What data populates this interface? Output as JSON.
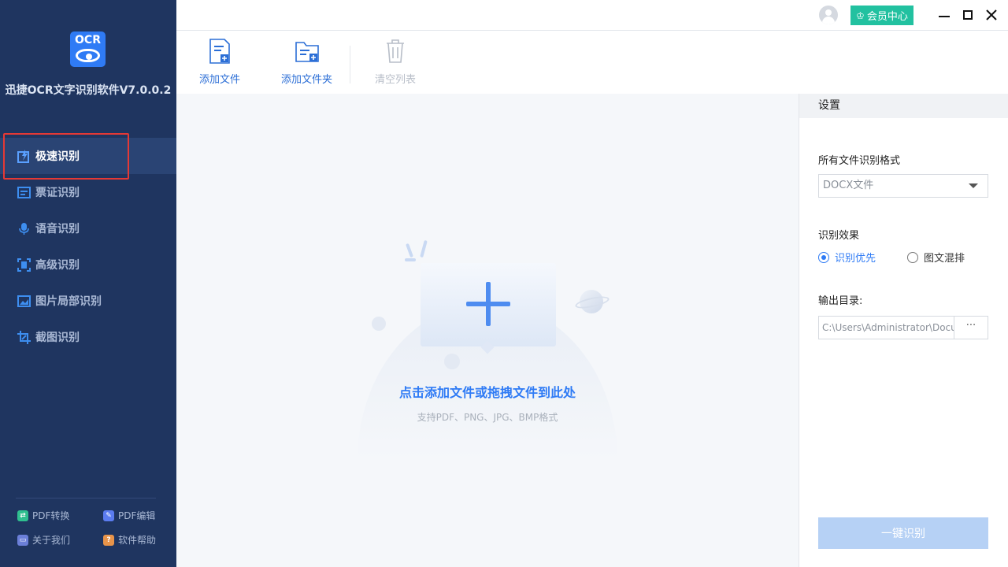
{
  "app": {
    "logo_text": "OCR",
    "title": "迅捷OCR文字识别软件V7.0.0.2"
  },
  "nav": {
    "items": [
      {
        "label": "极速识别",
        "icon": "lightning-doc-icon",
        "active": true
      },
      {
        "label": "票证识别",
        "icon": "ticket-icon"
      },
      {
        "label": "语音识别",
        "icon": "microphone-icon"
      },
      {
        "label": "高级识别",
        "icon": "scan-frame-icon"
      },
      {
        "label": "图片局部识别",
        "icon": "image-chart-icon"
      },
      {
        "label": "截图识别",
        "icon": "crop-icon"
      }
    ],
    "footer_links": [
      {
        "label": "PDF转换",
        "icon": "pdf-convert-icon",
        "color": "#2fbf8f"
      },
      {
        "label": "PDF编辑",
        "icon": "pdf-edit-icon",
        "color": "#5b7cf0"
      },
      {
        "label": "关于我们",
        "icon": "about-icon",
        "color": "#6b7fd8"
      },
      {
        "label": "软件帮助",
        "icon": "help-icon",
        "color": "#e8944a"
      }
    ]
  },
  "topbar": {
    "vip_label": "会员中心",
    "vip_color": "#22c1a0"
  },
  "toolbar": {
    "add_file": "添加文件",
    "add_folder": "添加文件夹",
    "clear_list": "清空列表"
  },
  "dropzone": {
    "main_text": "点击添加文件或拖拽文件到此处",
    "sub_text": "支持PDF、PNG、JPG、BMP格式"
  },
  "settings": {
    "header": "设置",
    "format_label": "所有文件识别格式",
    "format_value": "DOCX文件",
    "effect_label": "识别效果",
    "effect_options": [
      "识别优先",
      "图文混排"
    ],
    "effect_selected": "识别优先",
    "output_label": "输出目录:",
    "output_path": "C:\\Users\\Administrator\\Documents",
    "browse_label": "···",
    "start_label": "一键识别"
  },
  "colors": {
    "sidebar_bg": "#1f3560",
    "accent": "#2f7bf5"
  }
}
